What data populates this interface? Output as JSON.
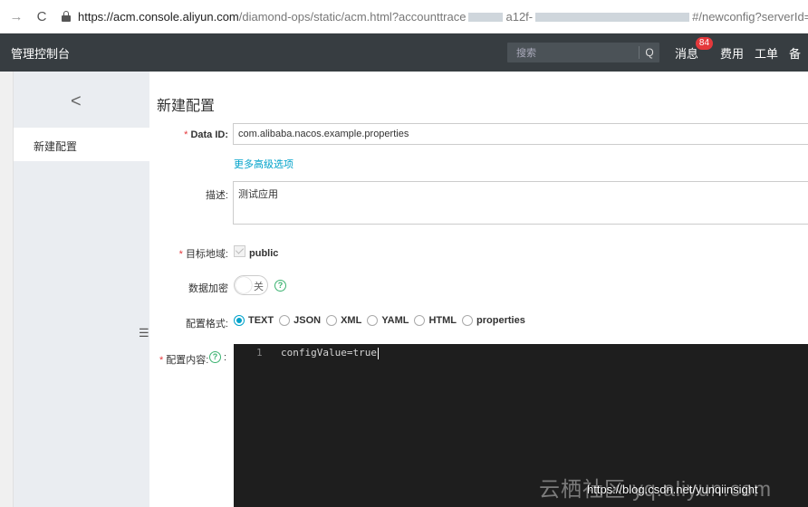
{
  "browser": {
    "back_icon": "→",
    "reload_icon": "C",
    "url_host": "https://acm.console.aliyun.com",
    "url_path": "/diamond-ops/static/acm.html?accounttrace",
    "url_mid": "a12f-",
    "url_tail": "#/newconfig?serverId="
  },
  "topnav": {
    "brand": "管理控制台",
    "search_placeholder": "搜索",
    "search_icon": "Q",
    "items": [
      {
        "label": "消息",
        "badge": "84"
      },
      {
        "label": "费用"
      },
      {
        "label": "工单"
      },
      {
        "label": "备"
      }
    ]
  },
  "sidebar": {
    "back_icon": "<",
    "active_item": "新建配置",
    "rail_icon": "☰"
  },
  "page": {
    "title": "新建配置",
    "data_id_label": "Data ID:",
    "data_id_value": "com.alibaba.nacos.example.properties",
    "advanced_link": "更多高级选项",
    "desc_label": "描述:",
    "desc_value": "测试应用",
    "region_label": "目标地域:",
    "region_value": "public",
    "encrypt_label": "数据加密",
    "encrypt_toggle": "关",
    "format_label": "配置格式:",
    "formats": [
      "TEXT",
      "JSON",
      "XML",
      "YAML",
      "HTML",
      "properties"
    ],
    "selected_format": "TEXT",
    "content_label": "配置内容:",
    "content_colon": ":",
    "editor_line": "1",
    "editor_code": "configValue=true"
  },
  "watermark": {
    "text": "云栖社区 yq.aliyun.com",
    "csdn": "https://blog.csdn.net/yunqiinsight"
  },
  "colors": {
    "topnav_bg": "#373d41",
    "sidebar_bg": "#eaedf1",
    "accent": "#00a2ca",
    "required": "#e4393c",
    "editor_bg": "#1e1e1e"
  }
}
